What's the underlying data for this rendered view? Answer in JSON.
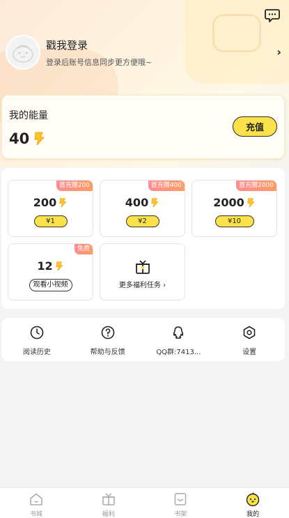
{
  "header": {
    "message_icon": "chat-bubble-icon"
  },
  "profile": {
    "title": "戳我登录",
    "subtitle": "登录后账号信息同步更方便哦~",
    "arrow": "›"
  },
  "energy": {
    "label": "我的能量",
    "value": "40",
    "recharge_label": "充值",
    "accent_color": "#fbe24a"
  },
  "packs": [
    {
      "tag": "首充赠200",
      "amount": "200",
      "price": "¥1"
    },
    {
      "tag": "首充赠400",
      "amount": "400",
      "price": "¥2"
    },
    {
      "tag": "首充赠2000",
      "amount": "2000",
      "price": "¥10"
    }
  ],
  "free_pack": {
    "tag": "免费",
    "amount": "12",
    "button": "观看小视频"
  },
  "more_tasks": {
    "label": "更多福利任务 ›"
  },
  "menu": [
    {
      "label": "阅读历史",
      "icon": "clock-history-icon"
    },
    {
      "label": "帮助与反馈",
      "icon": "question-circle-icon"
    },
    {
      "label": "QQ群:7413...",
      "icon": "qq-icon"
    },
    {
      "label": "设置",
      "icon": "hexagon-settings-icon"
    }
  ],
  "tabs": [
    {
      "label": "书城",
      "icon": "house-icon"
    },
    {
      "label": "福利",
      "icon": "gift-box-icon"
    },
    {
      "label": "书架",
      "icon": "bookshelf-icon"
    },
    {
      "label": "我的",
      "icon": "chick-face-icon"
    }
  ]
}
